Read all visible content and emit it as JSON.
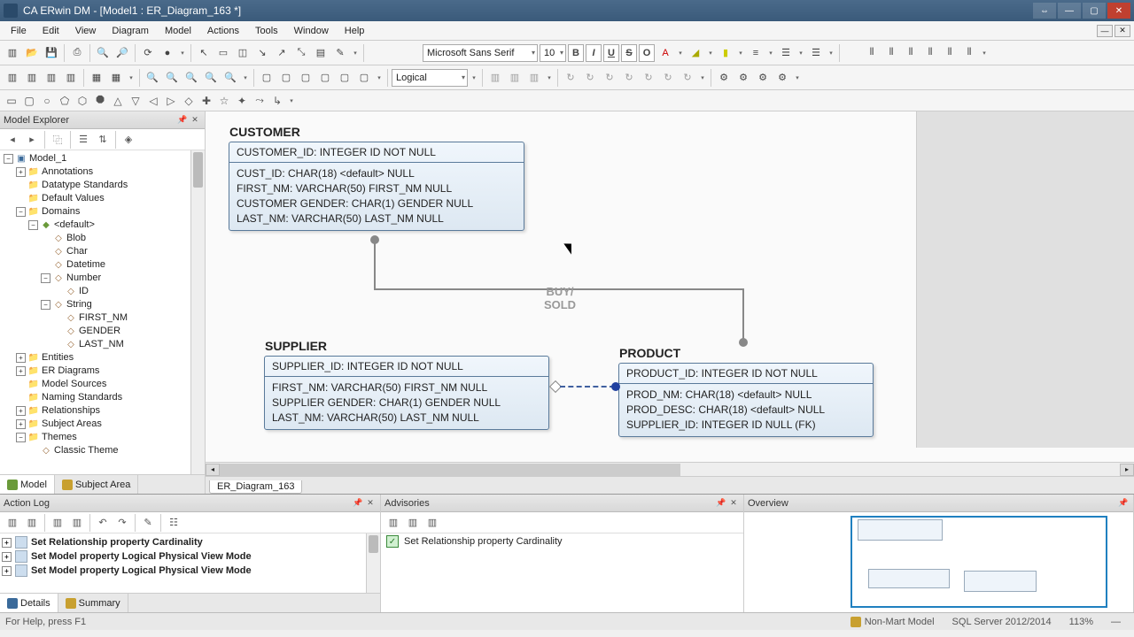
{
  "window": {
    "title": "CA ERwin DM - [Model1 : ER_Diagram_163 *]"
  },
  "menu": {
    "items": [
      "File",
      "Edit",
      "View",
      "Diagram",
      "Model",
      "Actions",
      "Tools",
      "Window",
      "Help"
    ]
  },
  "fontbar": {
    "font": "Microsoft Sans Serif",
    "size": "10",
    "bold": "B",
    "italic": "I",
    "underline": "U",
    "strike": "S",
    "over": "O"
  },
  "view_combo": "Logical",
  "explorer": {
    "title": "Model Explorer",
    "root": "Model_1",
    "nodes": {
      "annotations": "Annotations",
      "datatype_std": "Datatype Standards",
      "default_vals": "Default Values",
      "domains": "Domains",
      "default": "<default>",
      "blob": "Blob",
      "char": "Char",
      "datetime": "Datetime",
      "number": "Number",
      "id": "ID",
      "string": "String",
      "first_nm": "FIRST_NM",
      "gender": "GENDER",
      "last_nm": "LAST_NM",
      "entities": "Entities",
      "er_diagrams": "ER Diagrams",
      "model_sources": "Model Sources",
      "naming_std": "Naming Standards",
      "relationships": "Relationships",
      "subject_areas": "Subject Areas",
      "themes": "Themes",
      "classic_theme": "Classic Theme"
    },
    "tabs": {
      "model": "Model",
      "subject_area": "Subject Area"
    }
  },
  "diagram": {
    "tab": "ER_Diagram_163",
    "customer": {
      "title": "CUSTOMER",
      "pk": "CUSTOMER_ID: INTEGER ID NOT NULL",
      "a1": "CUST_ID: CHAR(18) <default> NULL",
      "a2": "FIRST_NM: VARCHAR(50) FIRST_NM NULL",
      "a3": "CUSTOMER GENDER: CHAR(1) GENDER NULL",
      "a4": "LAST_NM: VARCHAR(50) LAST_NM NULL"
    },
    "supplier": {
      "title": "SUPPLIER",
      "pk": "SUPPLIER_ID: INTEGER ID NOT NULL",
      "a1": "FIRST_NM: VARCHAR(50) FIRST_NM NULL",
      "a2": "SUPPLIER GENDER: CHAR(1) GENDER NULL",
      "a3": "LAST_NM: VARCHAR(50) LAST_NM NULL"
    },
    "product": {
      "title": "PRODUCT",
      "pk": "PRODUCT_ID: INTEGER ID NOT NULL",
      "a1": "PROD_NM: CHAR(18) <default> NULL",
      "a2": "PROD_DESC: CHAR(18) <default> NULL",
      "a3": "SUPPLIER_ID: INTEGER ID NULL (FK)"
    },
    "rel_label": "BUY/\nSOLD"
  },
  "action_log": {
    "title": "Action Log",
    "i1": "Set Relationship property Cardinality",
    "i2": "Set Model property Logical Physical View Mode",
    "i3": "Set Model property Logical Physical View Mode",
    "tabs": {
      "details": "Details",
      "summary": "Summary"
    }
  },
  "advisories": {
    "title": "Advisories",
    "i1": "Set Relationship property Cardinality"
  },
  "overview": {
    "title": "Overview"
  },
  "status": {
    "help": "For Help, press F1",
    "model_type": "Non-Mart Model",
    "server": "SQL Server 2012/2014",
    "zoom": "113%"
  }
}
